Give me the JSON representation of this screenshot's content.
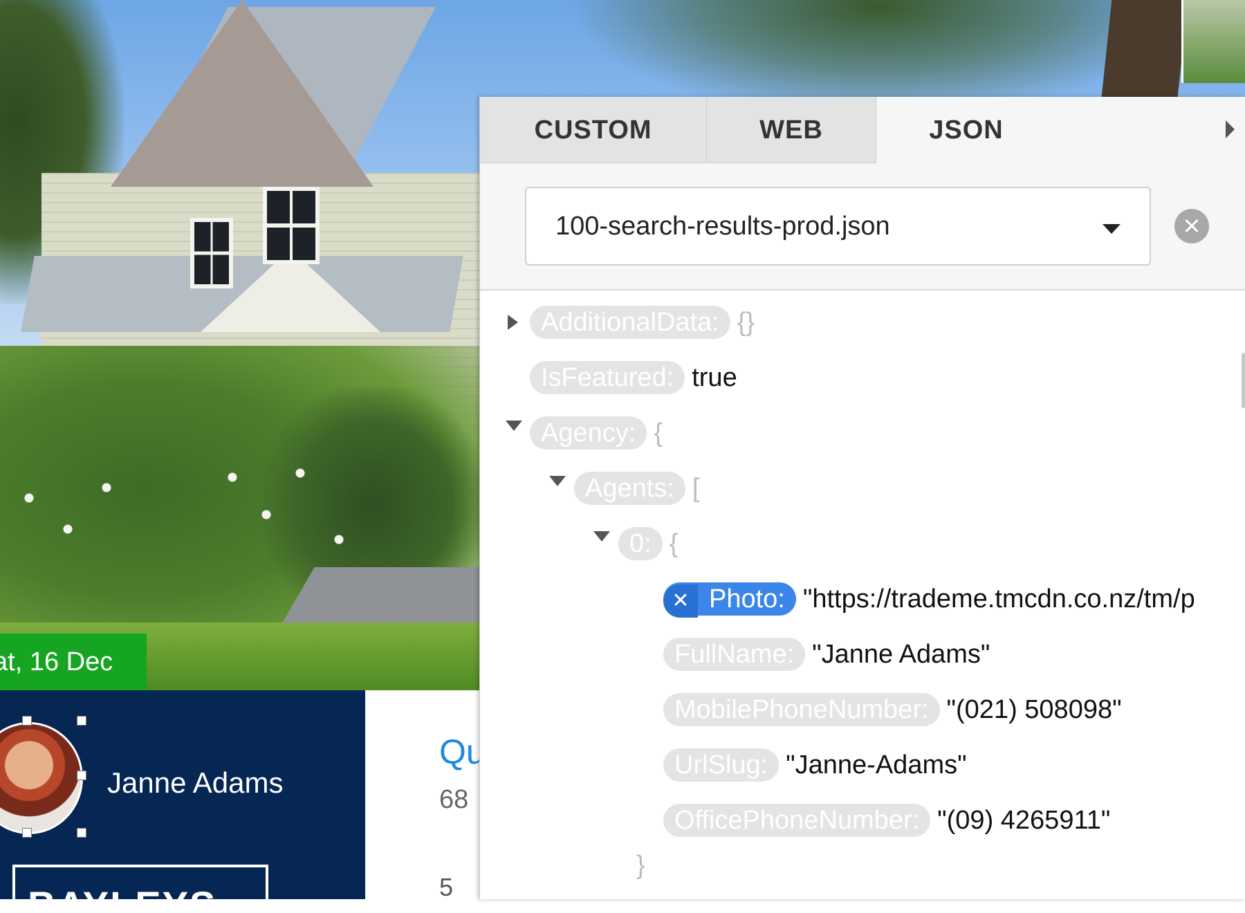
{
  "listing": {
    "open_home_label": "at, 16 Dec",
    "agent_name": "Janne Adams",
    "agency_logo_text": "BAYLEYS",
    "title_partial": "Qu",
    "price_partial": "68",
    "beds_partial": "5"
  },
  "panel": {
    "tabs": [
      {
        "label": "CUSTOM",
        "active": false
      },
      {
        "label": "WEB",
        "active": false
      },
      {
        "label": "JSON",
        "active": true
      }
    ],
    "file_select": {
      "value": "100-search-results-prod.json"
    },
    "tree": {
      "additional_data": {
        "key": "AdditionalData:",
        "value": "{}"
      },
      "is_featured": {
        "key": "IsFeatured:",
        "value": "true"
      },
      "agency": {
        "key": "Agency:",
        "open": "{"
      },
      "agents": {
        "key": "Agents:",
        "open": "["
      },
      "item0": {
        "key": "0:",
        "open": "{"
      },
      "photo": {
        "key": "Photo:",
        "value": "\"https://trademe.tmcdn.co.nz/tm/p"
      },
      "full_name": {
        "key": "FullName:",
        "value": "\"Janne Adams\""
      },
      "mobile": {
        "key": "MobilePhoneNumber:",
        "value": "\"(021) 508098\""
      },
      "url_slug": {
        "key": "UrlSlug:",
        "value": "\"Janne-Adams\""
      },
      "office": {
        "key": "OfficePhoneNumber:",
        "value": "\"(09) 4265911\""
      },
      "item0_close": "}"
    }
  },
  "colors": {
    "open_badge": "#16a521",
    "agent_band": "#062654",
    "selected_key": "#3b86e8",
    "key_pill": "#e4e4e4"
  },
  "icons": {
    "clear": "close-circle-icon",
    "dropdown": "caret-down-icon",
    "tab_scroll": "chevron-right-icon",
    "tree_toggle": "disclosure-triangle-icon"
  }
}
